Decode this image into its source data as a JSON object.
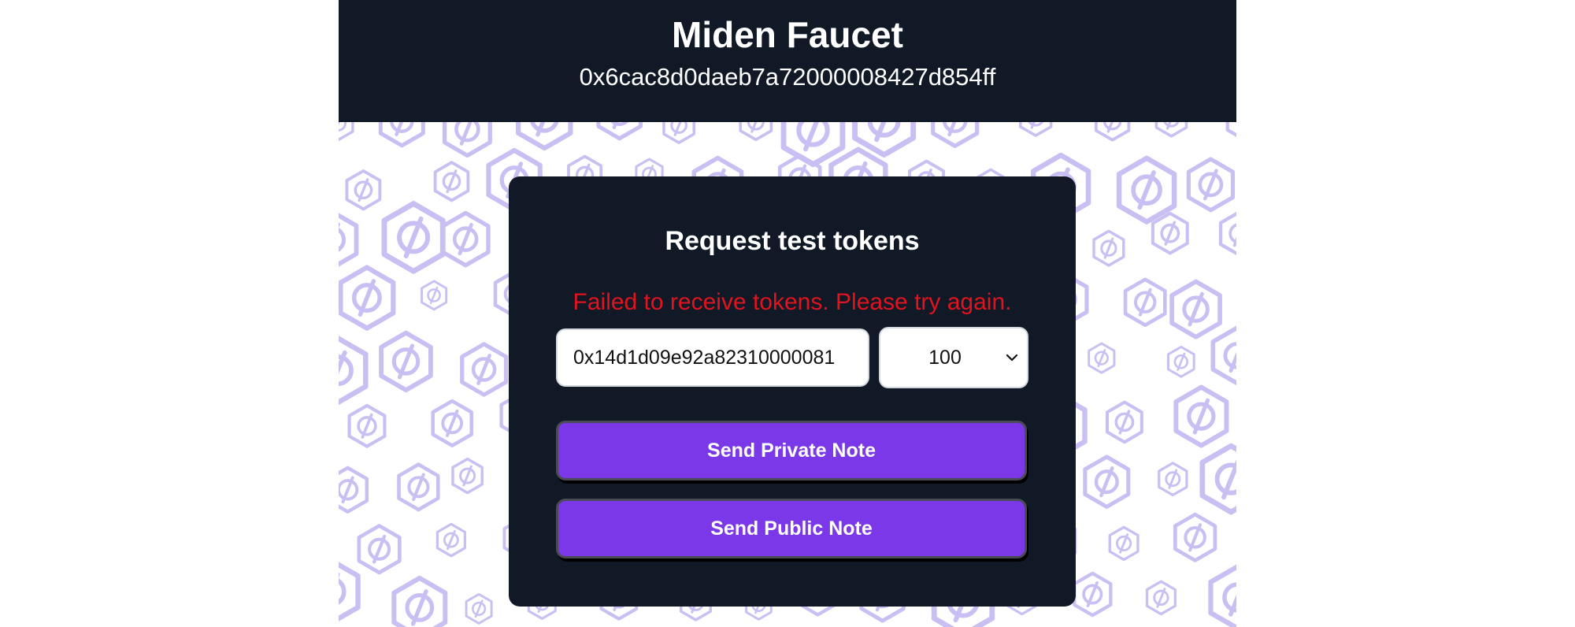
{
  "header": {
    "title": "Miden Faucet",
    "faucet_address": "0x6cac8d0daeb7a72000008427d854ff"
  },
  "background": {
    "pattern_icon": "miden-logo-hexagon-icon",
    "pattern_color": "#c9bff2"
  },
  "card": {
    "title": "Request test tokens",
    "error_message": "Failed to receive tokens. Please try again.",
    "account_input": {
      "value": "0x14d1d09e92a82310000081",
      "placeholder": ""
    },
    "amount_select": {
      "selected": "100"
    },
    "buttons": {
      "private_note": "Send Private Note",
      "public_note": "Send Public Note"
    }
  },
  "colors": {
    "dark_background": "#111927",
    "button_purple": "#7a38e8",
    "error_red": "#e0141e"
  }
}
